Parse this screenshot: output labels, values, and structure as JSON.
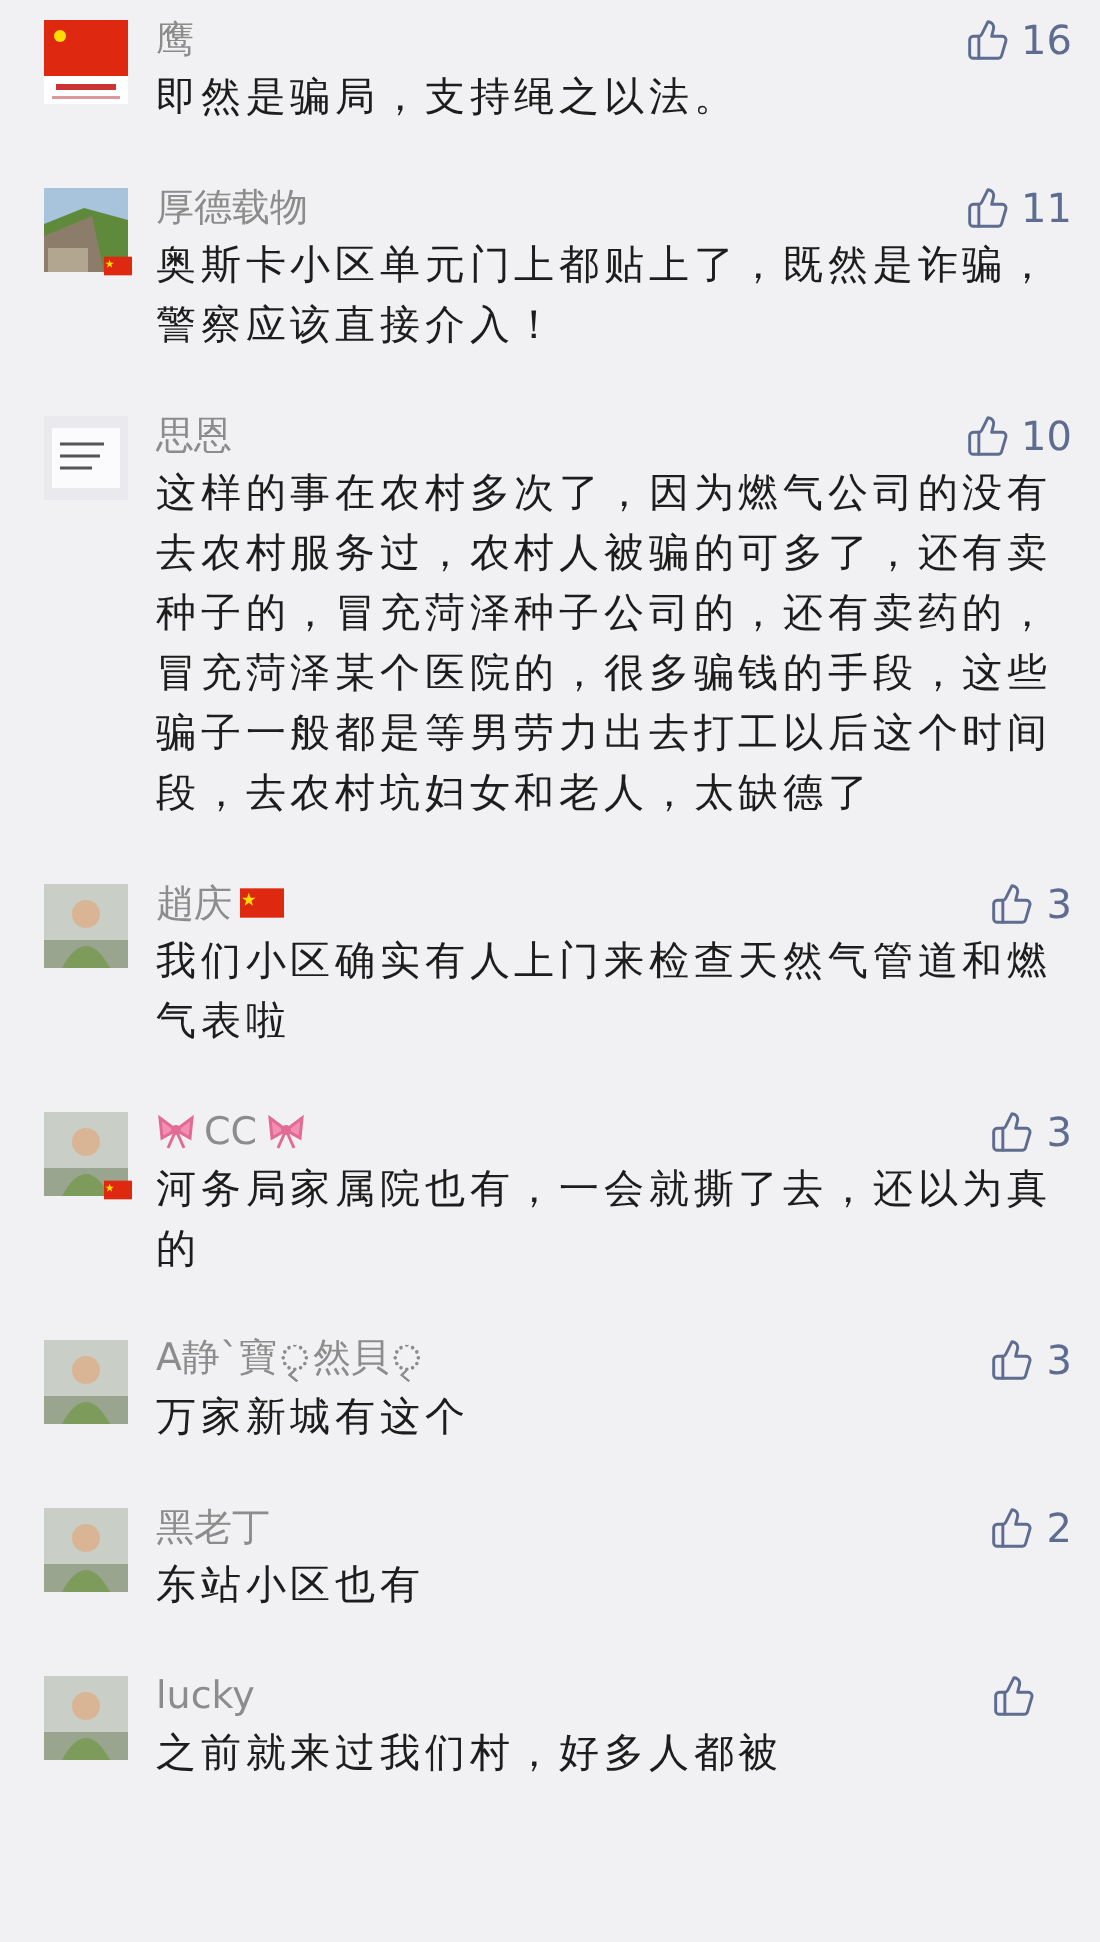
{
  "comments": [
    {
      "name": "鹰",
      "name_flag": false,
      "name_ribbons": false,
      "avatar": {
        "kind": "flag",
        "flag_badge": false
      },
      "likes": "16",
      "text": "即然是骗局，支持绳之以法。"
    },
    {
      "name": "厚德载物",
      "name_flag": false,
      "name_ribbons": false,
      "avatar": {
        "kind": "wall",
        "flag_badge": true
      },
      "likes": "11",
      "text": "奥斯卡小区单元门上都贴上了，既然是诈骗，警察应该直接介入！"
    },
    {
      "name": "思恩",
      "name_flag": false,
      "name_ribbons": false,
      "avatar": {
        "kind": "paper",
        "flag_badge": false
      },
      "likes": "10",
      "text": "这样的事在农村多次了，因为燃气公司的没有去农村服务过，农村人被骗的可多了，还有卖种子的，冒充菏泽种子公司的，还有卖药的，冒充菏泽某个医院的，很多骗钱的手段，这些骗子一般都是等男劳力出去打工以后这个时间段，去农村坑妇女和老人，太缺德了"
    },
    {
      "name": "趙庆",
      "name_flag": true,
      "name_ribbons": false,
      "avatar": {
        "kind": "person",
        "flag_badge": false
      },
      "likes": "3",
      "text": "我们小区确实有人上门来检查天然气管道和燃气表啦"
    },
    {
      "name": "CC",
      "name_flag": false,
      "name_ribbons": true,
      "avatar": {
        "kind": "person",
        "flag_badge": true
      },
      "likes": "3",
      "text": "河务局家属院也有，一会就撕了去，还以为真的"
    },
    {
      "name": "A静`寶ৃৃৃৃ然貝ৃৃ",
      "name_flag": false,
      "name_ribbons": false,
      "avatar": {
        "kind": "person",
        "flag_badge": false
      },
      "likes": "3",
      "text": "万家新城有这个"
    },
    {
      "name": "黑老丁",
      "name_flag": false,
      "name_ribbons": false,
      "avatar": {
        "kind": "person",
        "flag_badge": false
      },
      "likes": "2",
      "text": "东站小区也有"
    },
    {
      "name": "lucky",
      "name_flag": false,
      "name_ribbons": false,
      "avatar": {
        "kind": "person",
        "flag_badge": false
      },
      "text": "之前就来过我们村，好多人都被"
    }
  ]
}
